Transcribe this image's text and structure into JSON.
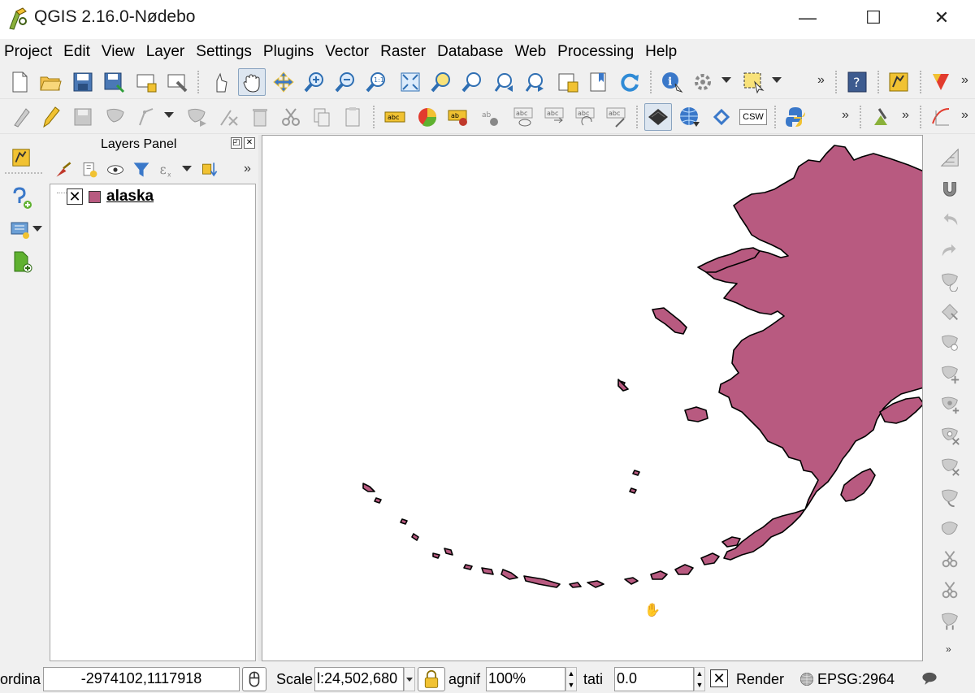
{
  "window": {
    "title": "QGIS 2.16.0-Nødebo",
    "minimize_glyph": "—",
    "maximize_glyph": "☐",
    "close_glyph": "✕"
  },
  "menubar": {
    "items": [
      "Project",
      "Edit",
      "View",
      "Layer",
      "Settings",
      "Plugins",
      "Vector",
      "Raster",
      "Database",
      "Web",
      "Processing",
      "Help"
    ]
  },
  "toolbar1": {
    "icons": [
      "new-project-icon",
      "open-project-icon",
      "save-project-icon",
      "save-as-icon",
      "new-print-composer-icon",
      "composer-manager-icon",
      "touch-zoom-icon",
      "pan-map-icon",
      "pan-to-selection-icon",
      "zoom-in-icon",
      "zoom-out-icon",
      "zoom-actual-size-icon",
      "zoom-full-icon",
      "zoom-to-selection-icon",
      "zoom-to-layer-icon",
      "zoom-last-icon",
      "zoom-next-icon",
      "new-map-view-icon",
      "new-bookmark-icon",
      "refresh-icon",
      "identify-icon",
      "run-feature-action-icon",
      "select-features-icon",
      "help-icon",
      "georeferencer-icon",
      "gps-icon"
    ],
    "more_glyph": "»"
  },
  "toolbar2": {
    "icons": [
      "current-edits-icon",
      "toggle-editing-icon",
      "save-edits-icon",
      "add-feature-icon",
      "move-feature-icon",
      "node-tool-icon",
      "delete-selected-icon",
      "cut-features-icon",
      "copy-features-icon",
      "paste-features-icon",
      "label-tool-icon",
      "diagram-icon",
      "pin-labels-icon",
      "highlight-pinned-labels-icon",
      "show-hide-labels-icon",
      "move-label-icon",
      "rotate-label-icon",
      "change-label-icon",
      "raster-terrain-icon",
      "web-globe-icon",
      "metasearch-icon",
      "csw-icon",
      "python-console-icon",
      "processing-toolbox-icon",
      "plugin-tools-icon"
    ],
    "csw_label": "CSW",
    "abc_label": "abc",
    "more_glyph": "»"
  },
  "left_toolbar": {
    "icons": [
      "georeferencer-icon",
      "add-delimited-text-layer-icon",
      "add-virtual-layer-icon",
      "new-layer-icon"
    ]
  },
  "layers_panel": {
    "title": "Layers Panel",
    "float_glyph": "◰",
    "close_glyph": "✕",
    "more_glyph": "»",
    "tool_icons": [
      "style-manager-icon",
      "add-group-icon",
      "manage-visibility-icon",
      "filter-legend-icon",
      "filter-by-expression-icon",
      "expand-all-icon"
    ],
    "layers": [
      {
        "name": "alaska",
        "visible": true,
        "check_glyph": "✕",
        "swatch_color": "#b85a80"
      }
    ]
  },
  "map": {
    "fill_color": "#b85a80",
    "stroke_color": "#000000",
    "cursor_icon": "pan-hand-cursor-icon"
  },
  "right_toolbar": {
    "icons": [
      "snapping-icon",
      "magnet-icon",
      "undo-icon",
      "redo-icon",
      "rotate-feature-icon",
      "simplify-feature-icon",
      "add-ring-icon",
      "add-part-icon",
      "fill-ring-icon",
      "delete-ring-icon",
      "delete-part-icon",
      "reshape-icon",
      "offset-curve-icon",
      "split-features-icon",
      "split-parts-icon",
      "merge-features-icon"
    ],
    "more_glyph": "»"
  },
  "statusbar": {
    "coordinate_label": "ordina",
    "coordinate_value": "-2974102,1117918",
    "scale_label": "Scale",
    "scale_value": "l:24,502,680",
    "magnifier_label": "agnif",
    "magnifier_value": "100%",
    "rotation_label": "tati",
    "rotation_value": "0.0",
    "render_glyph": "✕",
    "render_label": "Render",
    "crs_value": "EPSG:2964"
  }
}
